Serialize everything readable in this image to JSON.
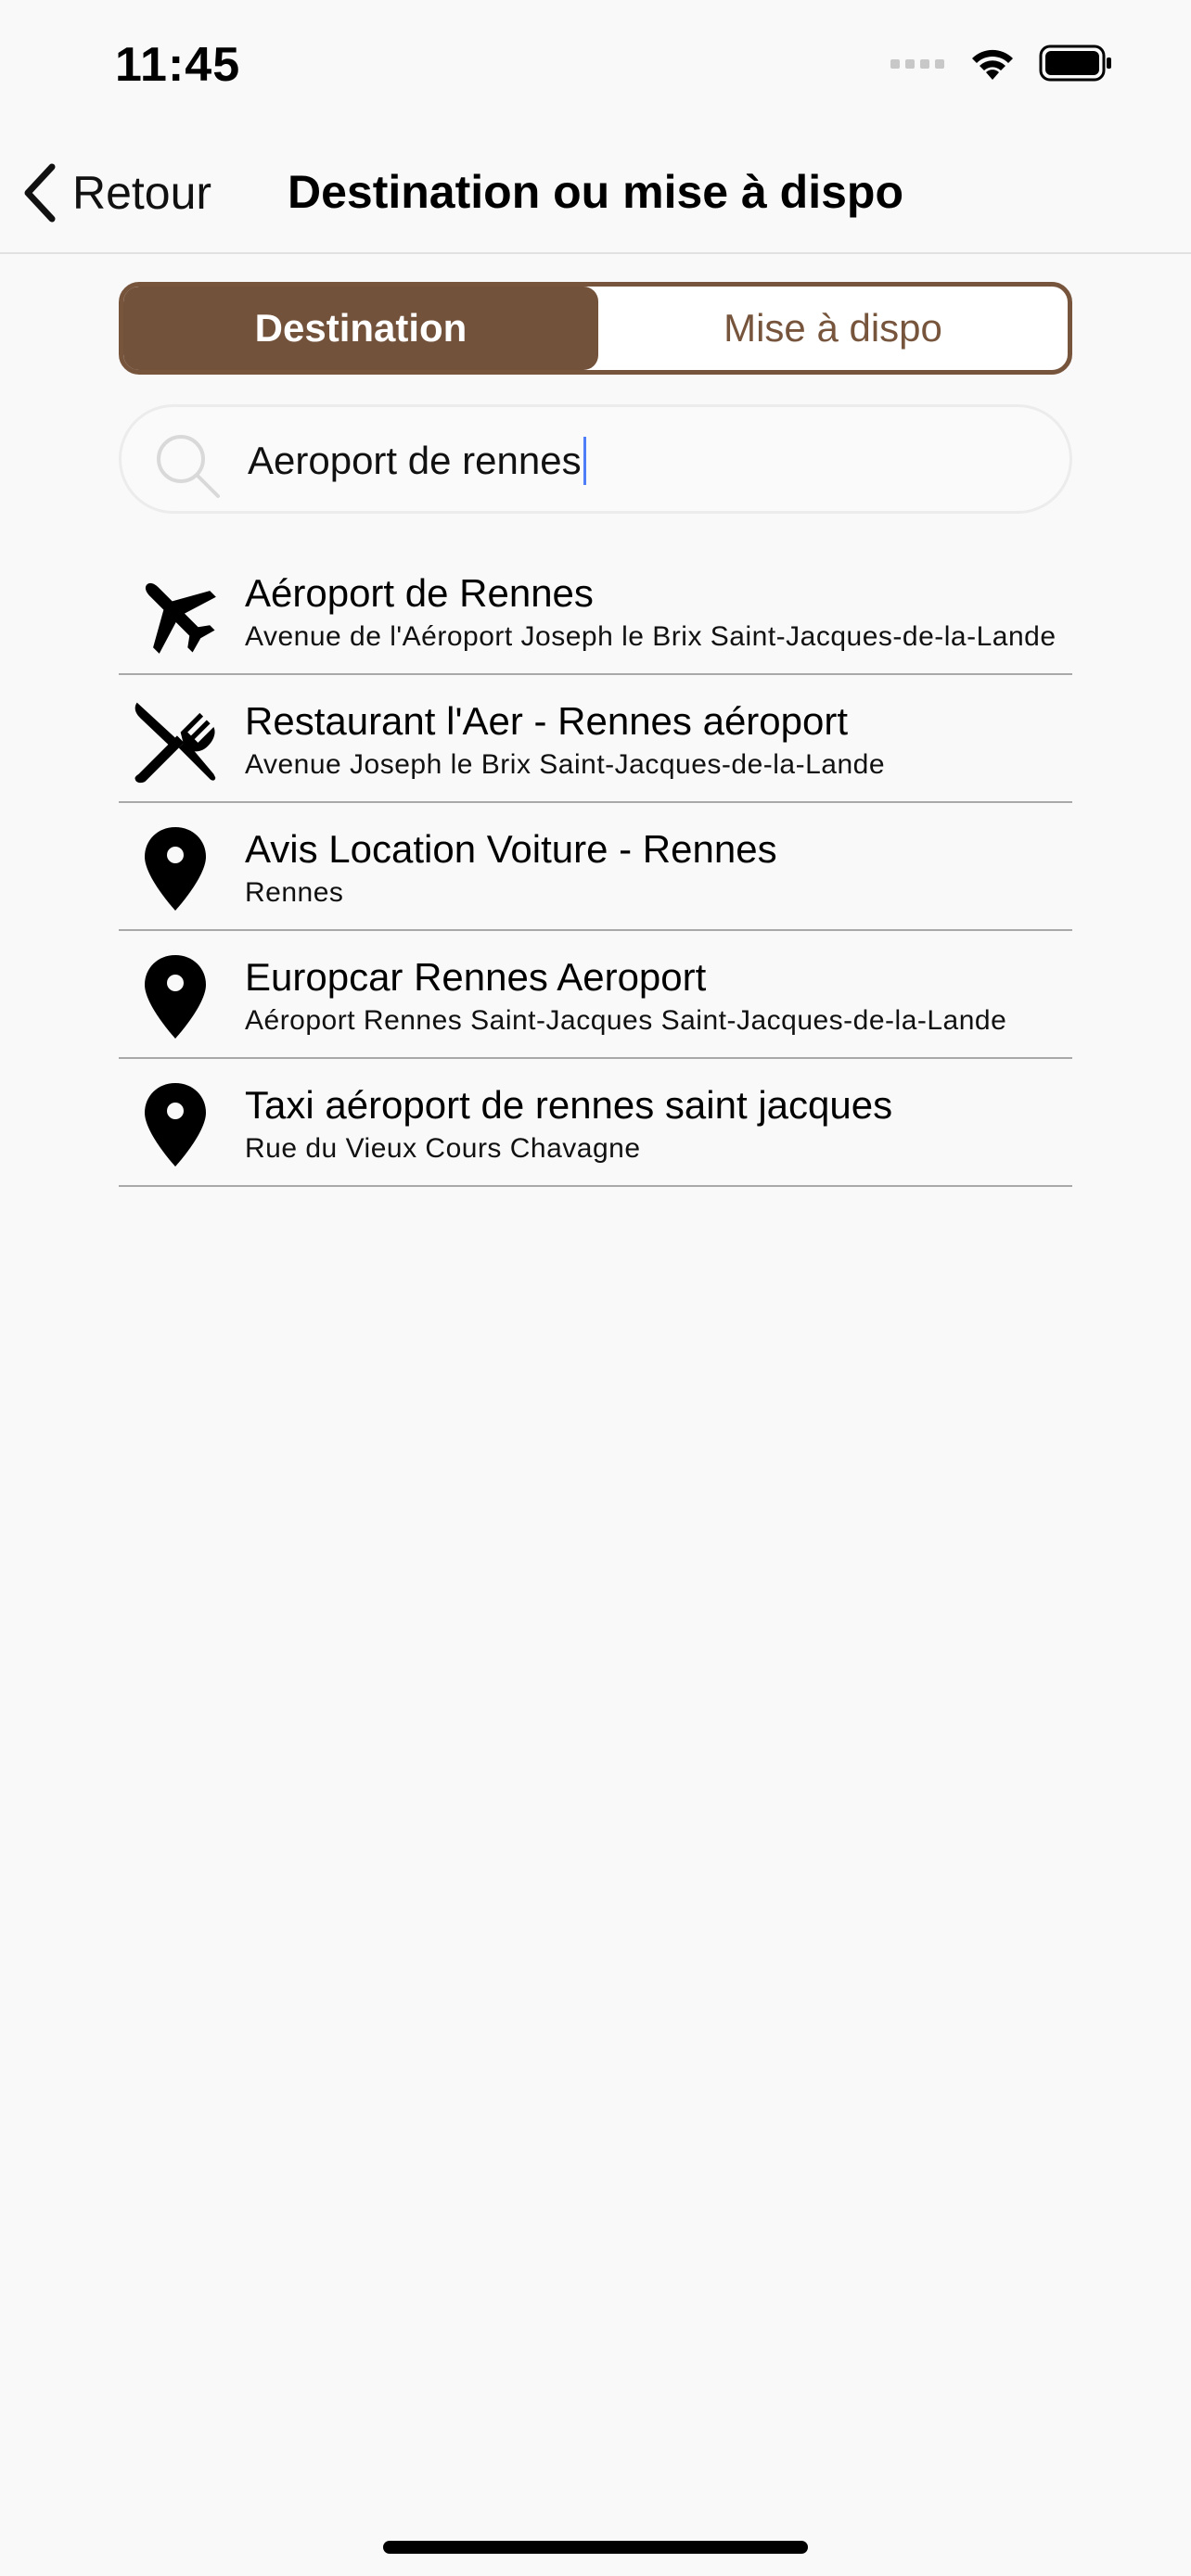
{
  "status_bar": {
    "time": "11:45"
  },
  "nav": {
    "back_label": "Retour",
    "title": "Destination ou mise à dispo"
  },
  "segmented": {
    "options": [
      "Destination",
      "Mise à dispo"
    ],
    "selected": "Destination"
  },
  "search": {
    "value": "Aeroport de rennes"
  },
  "results": [
    {
      "icon": "airplane-icon",
      "title": "Aéroport de Rennes",
      "subtitle": "Avenue de l'Aéroport Joseph le Brix Saint-Jacques-de-la-Lande"
    },
    {
      "icon": "fork-knife-icon",
      "title": "Restaurant l'Aer - Rennes aéroport",
      "subtitle": "Avenue Joseph le Brix Saint-Jacques-de-la-Lande"
    },
    {
      "icon": "map-pin-icon",
      "title": "Avis Location Voiture - Rennes",
      "subtitle": "Rennes"
    },
    {
      "icon": "map-pin-icon",
      "title": "Europcar Rennes Aeroport",
      "subtitle": "Aéroport Rennes Saint-Jacques Saint-Jacques-de-la-Lande"
    },
    {
      "icon": "map-pin-icon",
      "title": "Taxi aéroport de rennes saint jacques",
      "subtitle": "Rue du Vieux Cours Chavagne"
    }
  ],
  "colors": {
    "accent": "#73523b",
    "background": "#f9f9f9"
  }
}
